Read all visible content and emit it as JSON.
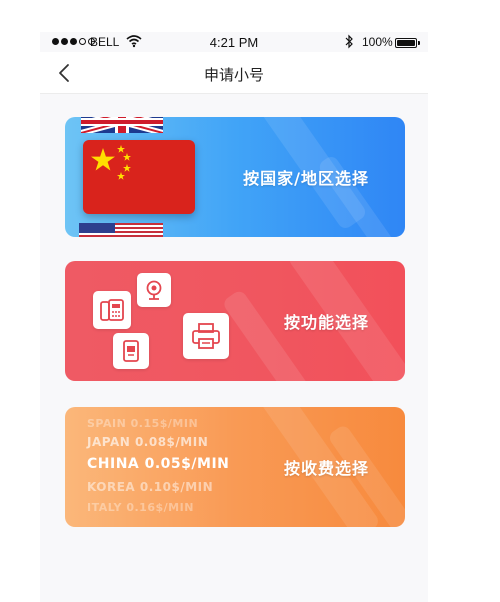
{
  "status_bar": {
    "carrier": "BELL",
    "time": "4:21 PM",
    "battery_percent": "100%"
  },
  "nav": {
    "title": "申请小号"
  },
  "cards": [
    {
      "label": "按国家/地区选择"
    },
    {
      "label": "按功能选择"
    },
    {
      "label": "按收费选择"
    }
  ],
  "rates": [
    {
      "text": "SPAIN 0.15$/MIN"
    },
    {
      "text": "JAPAN 0.08$/MIN"
    },
    {
      "text": "CHINA 0.05$/MIN"
    },
    {
      "text": "KOREA 0.10$/MIN"
    },
    {
      "text": "ITALY 0.16$/MIN"
    }
  ],
  "colors": {
    "card_blue": "#41a4f7",
    "card_red": "#f0565f",
    "card_orange": "#f99a55",
    "china_flag": "#d9231c",
    "star": "#ffde00"
  }
}
